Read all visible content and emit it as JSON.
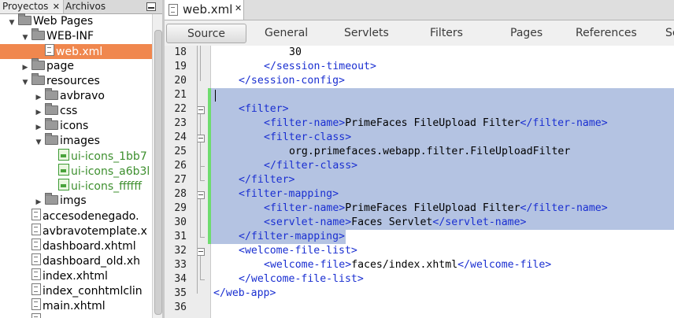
{
  "left_panel": {
    "tabs": [
      {
        "label": "Proyectos",
        "close": "✕"
      },
      {
        "label": "Archivos"
      }
    ],
    "tree": [
      {
        "label": "Web Pages",
        "icon": "web-pages-folder-icon",
        "toggle": "expanded",
        "depth": 0
      },
      {
        "label": "WEB-INF",
        "icon": "folder-icon",
        "toggle": "expanded",
        "depth": 1
      },
      {
        "label": "web.xml",
        "icon": "xml-file-icon",
        "toggle": "none",
        "depth": 2,
        "selected": true
      },
      {
        "label": "page",
        "icon": "folder-icon",
        "toggle": "collapsed",
        "depth": 1
      },
      {
        "label": "resources",
        "icon": "folder-icon",
        "toggle": "expanded",
        "depth": 1
      },
      {
        "label": "avbravo",
        "icon": "folder-icon",
        "toggle": "collapsed",
        "depth": 2
      },
      {
        "label": "css",
        "icon": "folder-icon",
        "toggle": "collapsed",
        "depth": 2
      },
      {
        "label": "icons",
        "icon": "folder-icon",
        "toggle": "collapsed",
        "depth": 2
      },
      {
        "label": "images",
        "icon": "folder-icon",
        "toggle": "expanded",
        "depth": 2
      },
      {
        "label": "ui-icons_1bb7",
        "icon": "image-file-icon",
        "toggle": "none",
        "depth": 3,
        "green": true
      },
      {
        "label": "ui-icons_a6b3l",
        "icon": "image-file-icon",
        "toggle": "none",
        "depth": 3,
        "green": true
      },
      {
        "label": "ui-icons_ffffff",
        "icon": "image-file-icon",
        "toggle": "none",
        "depth": 3,
        "green": true
      },
      {
        "label": "imgs",
        "icon": "folder-icon",
        "toggle": "collapsed",
        "depth": 2
      },
      {
        "label": "accesodenegado.",
        "icon": "xhtml-file-icon",
        "toggle": "none",
        "depth": 1
      },
      {
        "label": "avbravotemplate.x",
        "icon": "xhtml-file-icon",
        "toggle": "none",
        "depth": 1
      },
      {
        "label": "dashboard.xhtml",
        "icon": "xhtml-file-icon",
        "toggle": "none",
        "depth": 1
      },
      {
        "label": "dashboard_old.xh",
        "icon": "xhtml-file-icon",
        "toggle": "none",
        "depth": 1
      },
      {
        "label": "index.xhtml",
        "icon": "xhtml-file-icon",
        "toggle": "none",
        "depth": 1
      },
      {
        "label": "index_conhtmlclin",
        "icon": "xhtml-file-icon",
        "toggle": "none",
        "depth": 1
      },
      {
        "label": "main.xhtml",
        "icon": "xhtml-file-icon",
        "toggle": "none",
        "depth": 1
      },
      {
        "label": "",
        "icon": "xhtml-file-icon",
        "toggle": "none",
        "depth": 1
      }
    ]
  },
  "editor": {
    "file_tab": {
      "label": "web.xml",
      "close": "✕",
      "icon": "xml-file-icon"
    },
    "subtabs": [
      "Source",
      "General",
      "Servlets",
      "Filters",
      "Pages",
      "References",
      "Se"
    ],
    "active_subtab": "Source",
    "highlight_color": "#b4c3e2",
    "tag_color": "#1a2fd1",
    "lines": [
      {
        "n": "18",
        "indent": 12,
        "segs": [
          [
            "t",
            "30"
          ]
        ]
      },
      {
        "n": "19",
        "indent": 8,
        "segs": [
          [
            "g",
            "</session-timeout>"
          ]
        ]
      },
      {
        "n": "20",
        "indent": 4,
        "segs": [
          [
            "g",
            "</session-config>"
          ]
        ]
      },
      {
        "n": "21",
        "indent": 0,
        "segs": []
      },
      {
        "n": "22",
        "indent": 4,
        "segs": [
          [
            "g",
            "<filter>"
          ]
        ]
      },
      {
        "n": "23",
        "indent": 8,
        "segs": [
          [
            "g",
            "<filter-name>"
          ],
          [
            "t",
            "PrimeFaces FileUpload Filter"
          ],
          [
            "g",
            "</filter-name>"
          ]
        ]
      },
      {
        "n": "24",
        "indent": 8,
        "segs": [
          [
            "g",
            "<filter-class>"
          ]
        ]
      },
      {
        "n": "25",
        "indent": 12,
        "segs": [
          [
            "t",
            "org.primefaces.webapp.filter.FileUploadFilter"
          ]
        ]
      },
      {
        "n": "26",
        "indent": 8,
        "segs": [
          [
            "g",
            "</filter-class>"
          ]
        ]
      },
      {
        "n": "27",
        "indent": 4,
        "segs": [
          [
            "g",
            "</filter>"
          ]
        ]
      },
      {
        "n": "28",
        "indent": 4,
        "segs": [
          [
            "g",
            "<filter-mapping>"
          ]
        ]
      },
      {
        "n": "29",
        "indent": 8,
        "segs": [
          [
            "g",
            "<filter-name>"
          ],
          [
            "t",
            "PrimeFaces FileUpload Filter"
          ],
          [
            "g",
            "</filter-name>"
          ]
        ]
      },
      {
        "n": "30",
        "indent": 8,
        "segs": [
          [
            "g",
            "<servlet-name>"
          ],
          [
            "t",
            "Faces Servlet"
          ],
          [
            "g",
            "</servlet-name>"
          ]
        ]
      },
      {
        "n": "31",
        "indent": 4,
        "segs": [
          [
            "g",
            "</filter-mapping>"
          ]
        ]
      },
      {
        "n": "32",
        "indent": 4,
        "segs": [
          [
            "g",
            "<welcome-file-list>"
          ]
        ]
      },
      {
        "n": "33",
        "indent": 8,
        "segs": [
          [
            "g",
            "<welcome-file>"
          ],
          [
            "t",
            "faces/index.xhtml"
          ],
          [
            "g",
            "</welcome-file>"
          ]
        ]
      },
      {
        "n": "34",
        "indent": 4,
        "segs": [
          [
            "g",
            "</welcome-file-list>"
          ]
        ]
      },
      {
        "n": "35",
        "indent": 0,
        "segs": [
          [
            "g",
            "</web-app>"
          ]
        ]
      },
      {
        "n": "36",
        "indent": 0,
        "segs": []
      }
    ]
  }
}
